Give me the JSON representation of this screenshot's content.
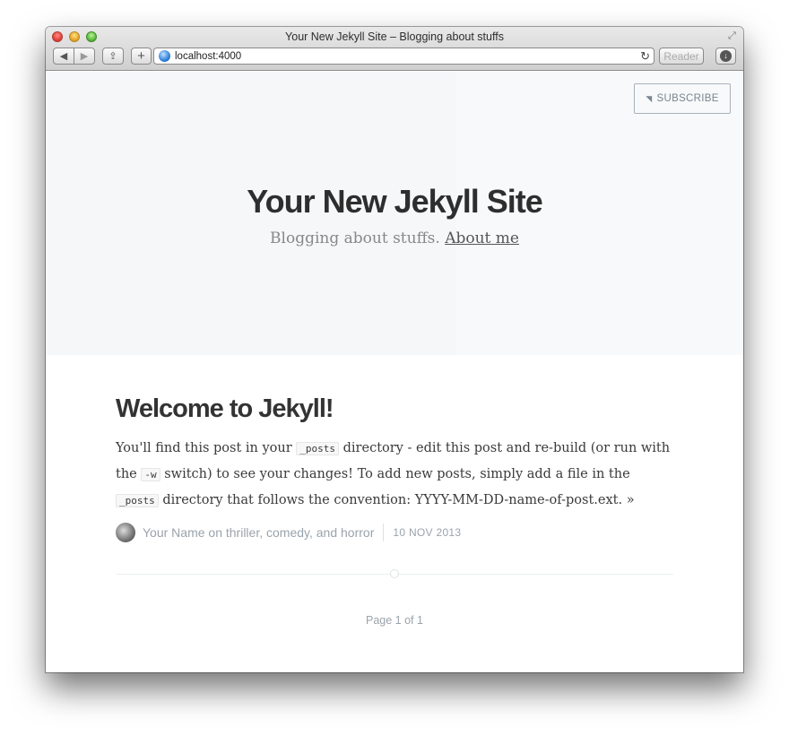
{
  "browser": {
    "window_title": "Your New Jekyll Site – Blogging about stuffs",
    "url": "localhost:4000",
    "reader_label": "Reader",
    "back_icon": "◀",
    "forward_icon": "▶",
    "share_icon": "⇪",
    "plus_icon": "+",
    "reload_icon": "↻",
    "download_icon": "↓",
    "fullscreen_icon": "⤢"
  },
  "header": {
    "subscribe_label": "SUBSCRIBE",
    "rss_icon": "◥",
    "site_title": "Your New Jekyll Site",
    "description": "Blogging about stuffs.",
    "about_link": "About me"
  },
  "post": {
    "title": "Welcome to Jekyll!",
    "excerpt": {
      "t1": "You'll find this post in your ",
      "code1": "_posts",
      "t2": " directory - edit this post and re-build (or run with the ",
      "code2": "-w",
      "t3": " switch) to see your changes! To add new posts, simply add a file in the ",
      "code3": "_posts",
      "t4": " directory that follows the convention: YYYY-MM-DD-name-of-post.ext. ",
      "more": "»"
    },
    "author_line": "Your Name on thriller, comedy, and horror",
    "date": "10 NOV 2013"
  },
  "pagination": {
    "text": "Page 1 of 1"
  },
  "colors": {
    "hero_bg": "#f5f7f9",
    "muted_text": "#9aa3ab",
    "title_text": "#2e2e2e"
  }
}
